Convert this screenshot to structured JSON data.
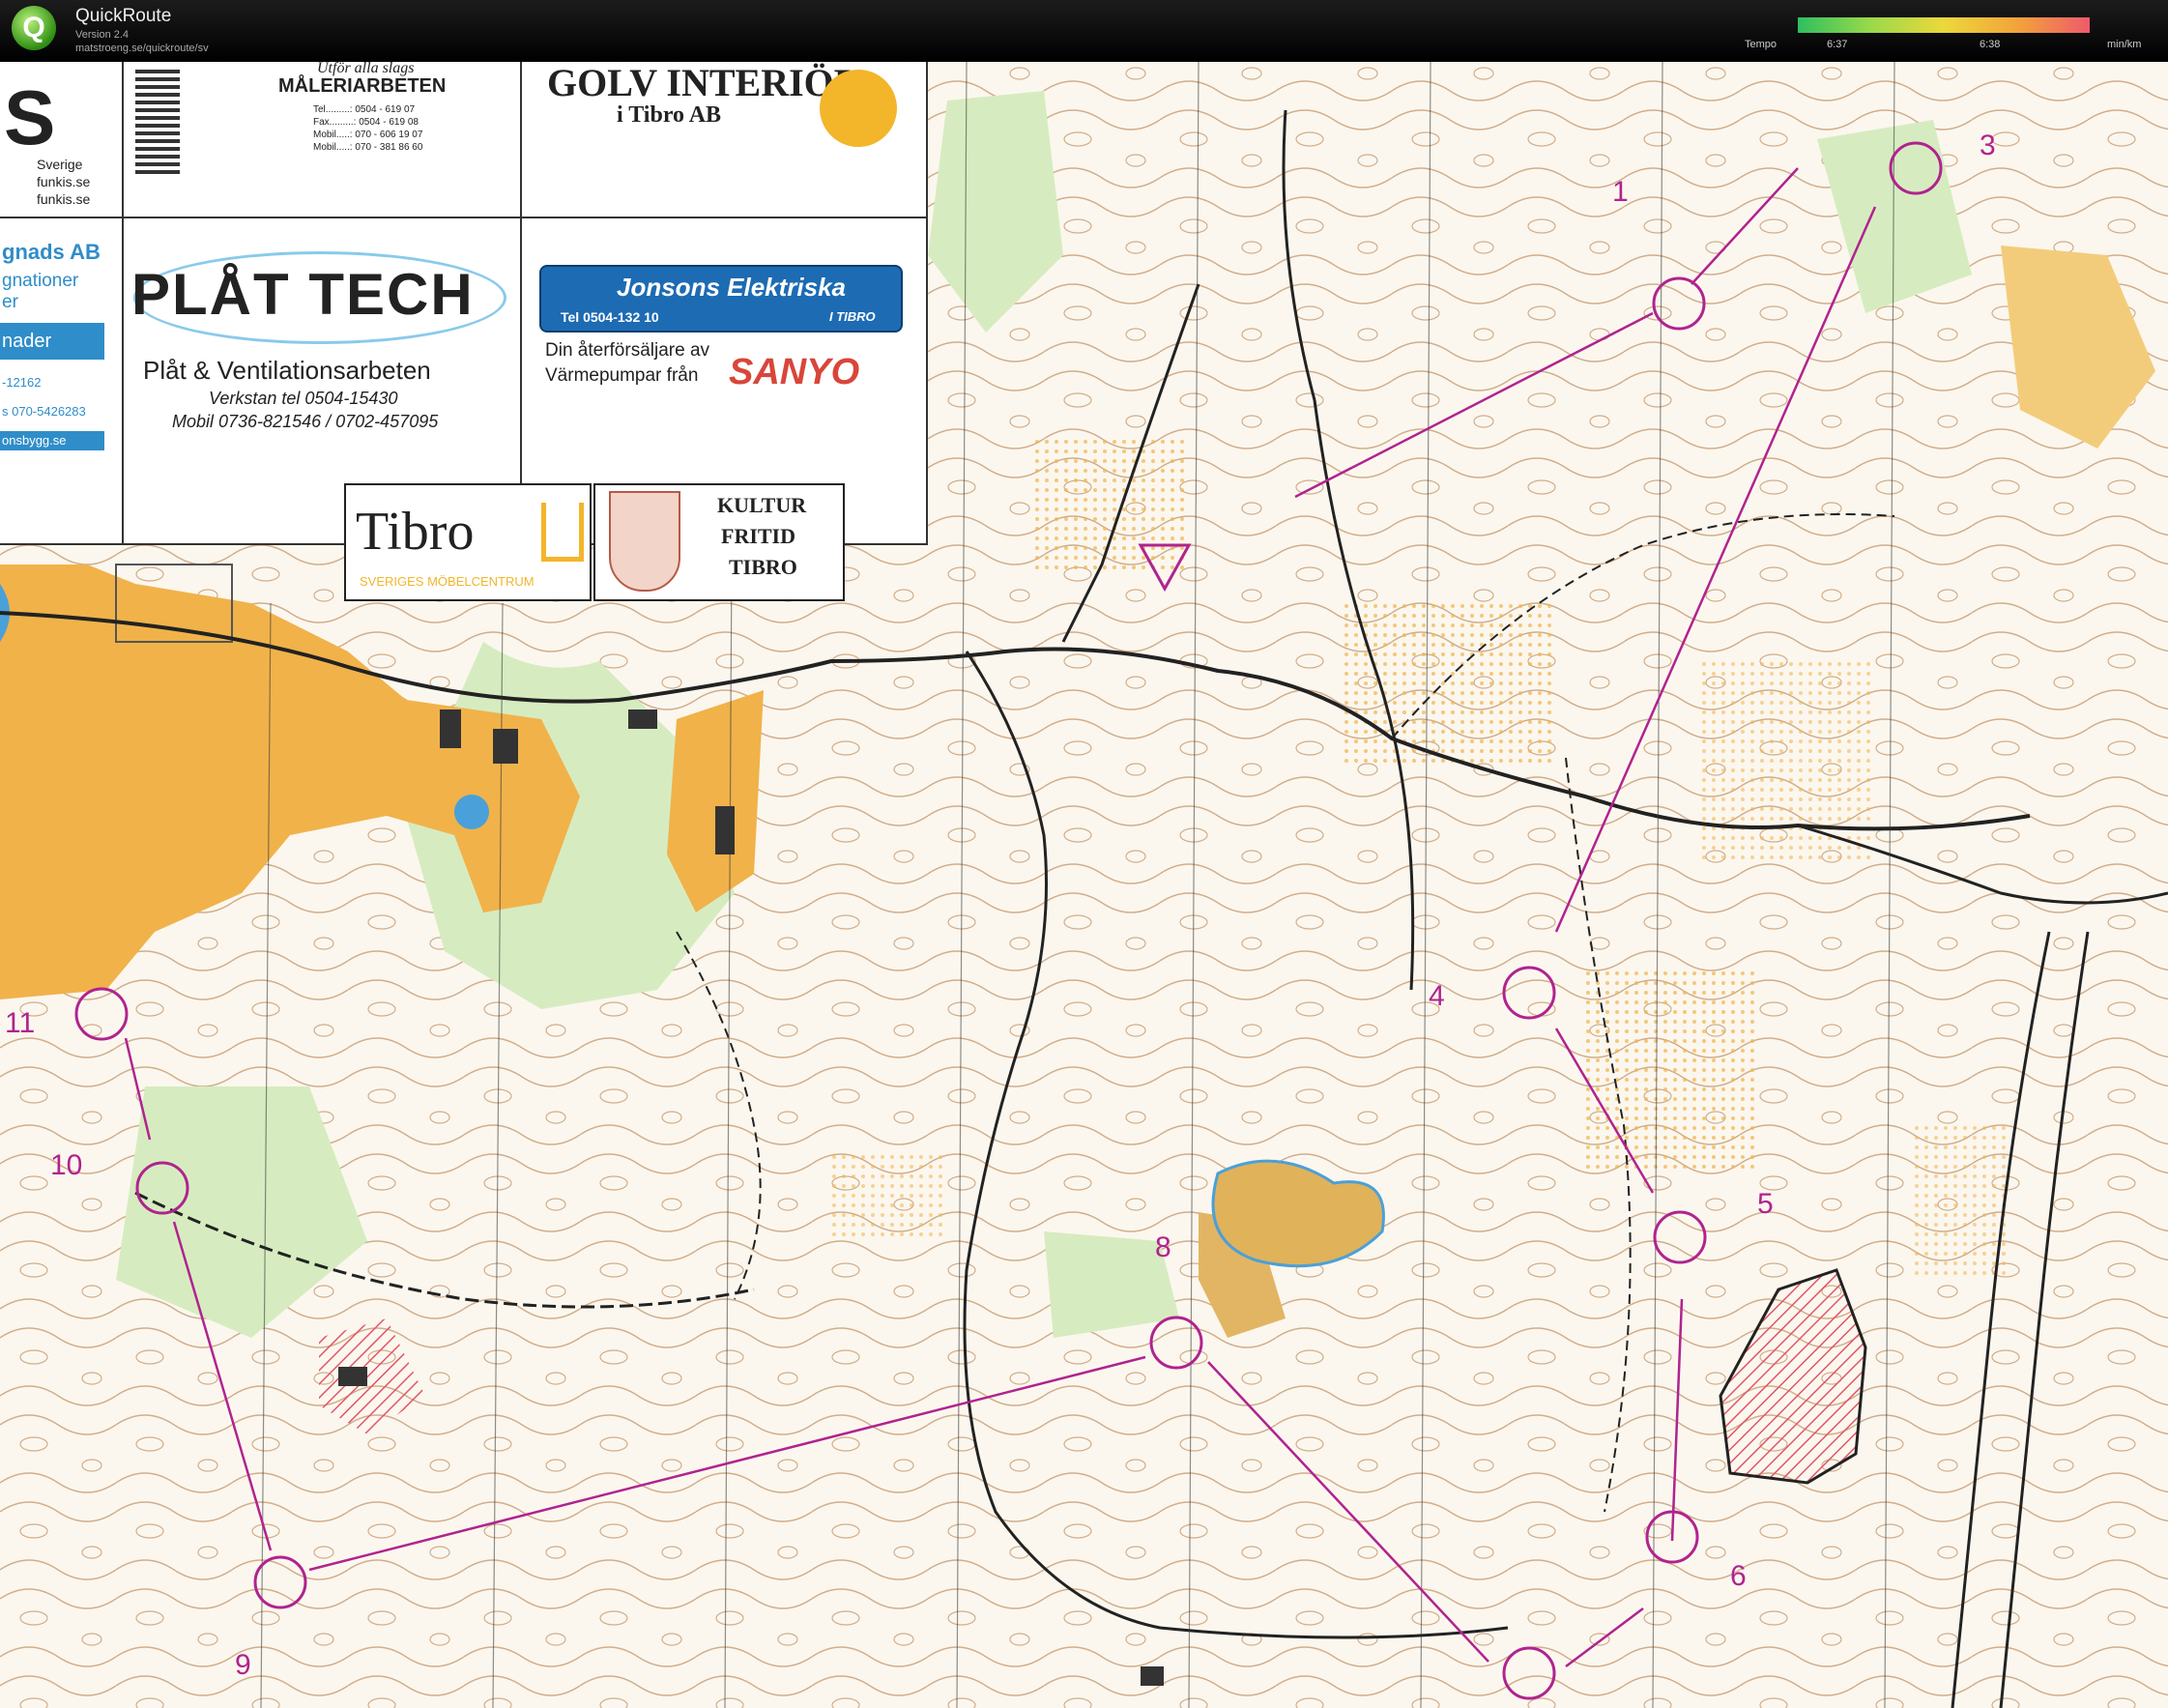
{
  "app": {
    "title": "QuickRoute",
    "version": "Version 2.4",
    "url": "matstroeng.se/quickroute/sv",
    "logo_letter": "Q"
  },
  "tempo": {
    "label": "Tempo",
    "tick1": "6:37",
    "tick2": "6:38",
    "unit": "min/km"
  },
  "ads": {
    "left_partial": {
      "letter": "S",
      "line1": "Sverige",
      "line2": "funkis.se",
      "line3": "funkis.se",
      "company": "gnads AB",
      "line4": "gnationer",
      "line5": "er",
      "line6": "nader",
      "line7": "-12162",
      "line8": "s 070-5426283",
      "line9": "onsbygg.se"
    },
    "maleri": {
      "slogan": "Utför alla slags",
      "title": "MÅLERIARBETEN",
      "tel": "Tel.........: 0504 - 619 07",
      "fax": "Fax.........: 0504 - 619 08",
      "mob1": "Mobil.....: 070 - 606 19 07",
      "mob2": "Mobil.....: 070 - 381 86 60"
    },
    "gulv": {
      "line1": "GOLV INTERIÖR",
      "line2": "i Tibro AB"
    },
    "platech": {
      "logo": "PLÅT TECH",
      "sub": "Plåt & Ventilationsarbeten",
      "verkstan": "Verkstan  tel  0504-15430",
      "mobil": "Mobil  0736-821546 / 0702-457095"
    },
    "jonsons": {
      "name": "Jonsons Elektriska",
      "tel": "Tel 0504-132 10",
      "town": "I TIBRO",
      "line1": "Din återförsäljare av",
      "line2": "Värmepumpar från",
      "brand": "SANYO"
    },
    "tibro": {
      "name": "Tibro",
      "sub": "SVERIGES MÖBELCENTRUM"
    },
    "kultur": {
      "l1": "KULTUR",
      "l2": "FRITID",
      "l3": "TIBRO"
    }
  },
  "colors": {
    "course": "#b0238f",
    "open_land": "#f1b24a",
    "rough_open": "#f7dc9f",
    "forest_green": "#cfe8b6",
    "water": "#4aa0d8",
    "contour": "#b8835a"
  },
  "controls": [
    {
      "label": "1"
    },
    {
      "label": "3"
    },
    {
      "label": "4"
    },
    {
      "label": "5"
    },
    {
      "label": "6"
    },
    {
      "label": "8"
    },
    {
      "label": "9"
    },
    {
      "label": "10"
    },
    {
      "label": "11"
    }
  ]
}
